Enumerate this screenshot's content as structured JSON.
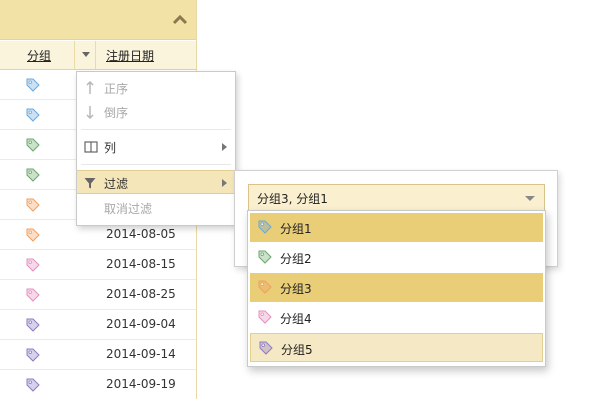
{
  "grid": {
    "columns": {
      "group": "分组",
      "date": "注册日期"
    },
    "rows": [
      {
        "tag_color": "#6aa8dd",
        "date": ""
      },
      {
        "tag_color": "#6aa8dd",
        "date": ""
      },
      {
        "tag_color": "#6aa86a",
        "date": ""
      },
      {
        "tag_color": "#6aa86a",
        "date": ""
      },
      {
        "tag_color": "#f0a060",
        "date": ""
      },
      {
        "tag_color": "#f0a060",
        "date": "2014-08-05"
      },
      {
        "tag_color": "#e58fc0",
        "date": "2014-08-15"
      },
      {
        "tag_color": "#e58fc0",
        "date": "2014-08-25"
      },
      {
        "tag_color": "#8e7bc4",
        "date": "2014-09-04"
      },
      {
        "tag_color": "#8e7bc4",
        "date": "2014-09-14"
      },
      {
        "tag_color": "#8e7bc4",
        "date": "2014-09-19"
      }
    ]
  },
  "menu": {
    "sort_asc": "正序",
    "sort_desc": "倒序",
    "columns": "列",
    "filter": "过滤",
    "clear_filter": "取消过滤"
  },
  "filter": {
    "selected_text": "分组3, 分组1",
    "options": [
      {
        "label": "分组1",
        "tag_color": "#6aa8dd",
        "state": "selected"
      },
      {
        "label": "分组2",
        "tag_color": "#6aa86a",
        "state": "normal"
      },
      {
        "label": "分组3",
        "tag_color": "#f0a060",
        "state": "selected"
      },
      {
        "label": "分组4",
        "tag_color": "#e58fc0",
        "state": "normal"
      },
      {
        "label": "分组5",
        "tag_color": "#8e7bc4",
        "state": "hover"
      }
    ]
  }
}
